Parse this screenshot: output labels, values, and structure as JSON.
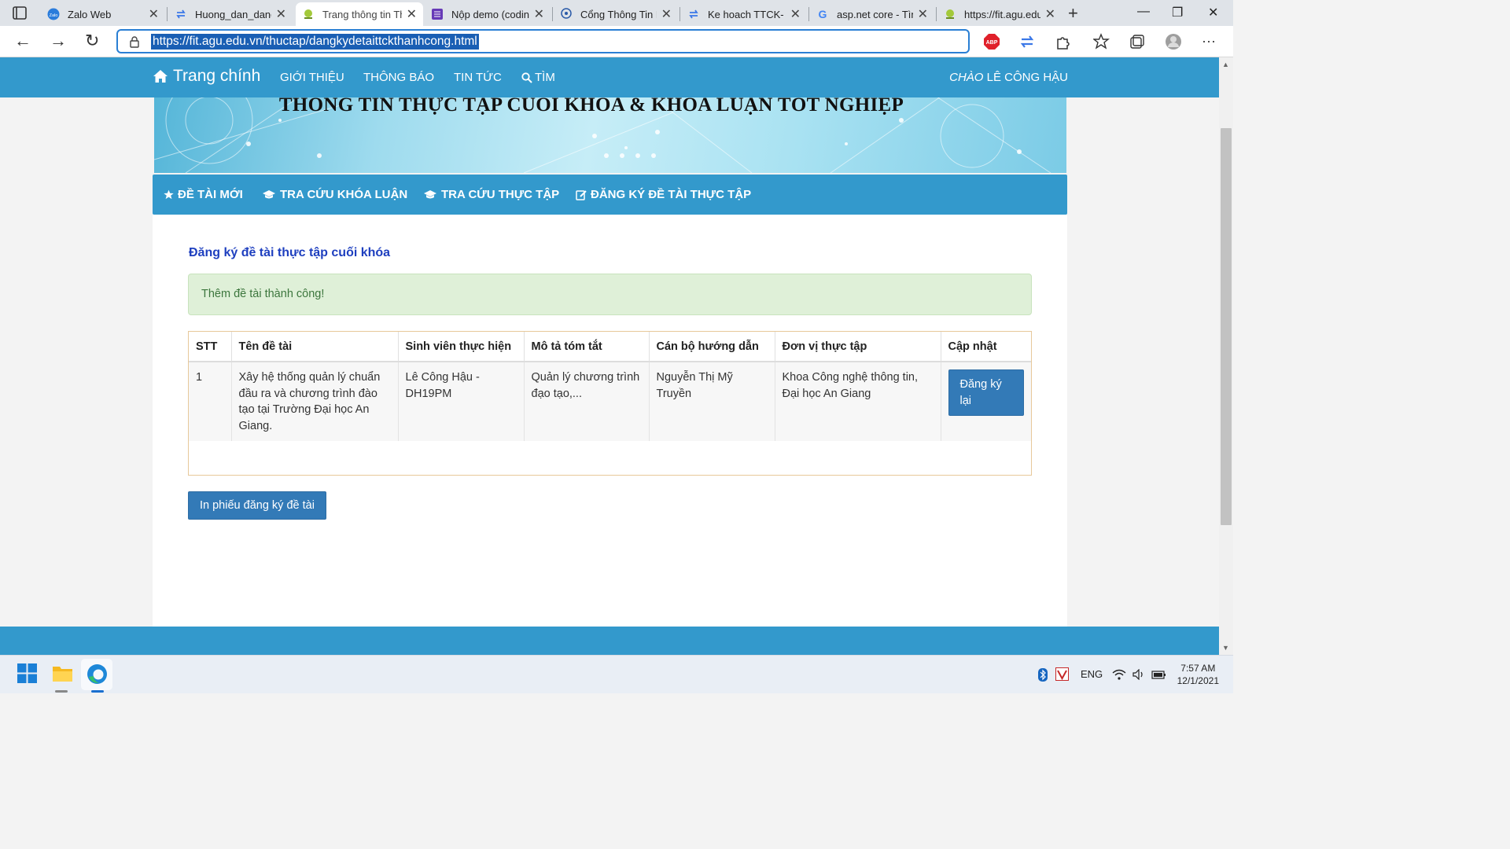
{
  "browser": {
    "tabs": [
      {
        "title": "Zalo Web",
        "icon": "zalo-icon",
        "active": false
      },
      {
        "title": "Huong_dan_dang",
        "icon": "sync-icon",
        "active": false
      },
      {
        "title": "Trang thông tin Th",
        "icon": "agu-icon",
        "active": true
      },
      {
        "title": "Nộp demo (codin",
        "icon": "form-icon",
        "active": false
      },
      {
        "title": "Cổng Thông Tin E",
        "icon": "agu-logo-icon",
        "active": false
      },
      {
        "title": "Ke hoach TTCK- K",
        "icon": "sync-icon",
        "active": false
      },
      {
        "title": "asp.net core - Tìn",
        "icon": "google-icon",
        "active": false
      },
      {
        "title": "https://fit.agu.edu",
        "icon": "agu-icon",
        "active": false
      }
    ],
    "url": "https://fit.agu.edu.vn/thuctap/dangkydetaittckthanhcong.html",
    "abp_label": "ABP"
  },
  "site": {
    "brand": "Trang chính",
    "nav": [
      "GIỚI THIỆU",
      "THÔNG BÁO",
      "TIN TỨC",
      "TÌM"
    ],
    "greeting_prefix": "CHÀO",
    "greeting_name": "LÊ CÔNG HẬU",
    "banner_title": "THÔNG TIN THỰC TẬP CUỐI KHÓA & KHÓA LUẬN TỐT NGHIỆP",
    "subnav": [
      "ĐỀ TÀI MỚI",
      "TRA CỨU KHÓA LUẬN",
      "TRA CỨU THỰC TẬP",
      "ĐĂNG KÝ ĐỀ TÀI THỰC TẬP"
    ]
  },
  "main": {
    "heading": "Đăng ký đề tài thực tập cuối khóa",
    "alert": "Thêm đề tài thành công!",
    "table": {
      "headers": [
        "STT",
        "Tên đề tài",
        "Sinh viên thực hiện",
        "Mô tả tóm tắt",
        "Cán bộ hướng dẫn",
        "Đơn vị thực tập",
        "Cập nhật"
      ],
      "rows": [
        {
          "stt": "1",
          "title": "Xây hệ thống quản lý chuẩn đầu ra và chương trình đào tạo tại Trường Đại học An Giang.",
          "student": "Lê Công Hậu - DH19PM",
          "summary": "Quản lý chương trình đạo tạo,...",
          "advisor": "Nguyễn Thị Mỹ Truyền",
          "unit": "Khoa Công nghệ thông tin, Đại học An Giang",
          "action": "Đăng ký lại"
        }
      ]
    },
    "print_button": "In phiếu đăng ký đề tài"
  },
  "taskbar": {
    "lang": "ENG",
    "time": "7:57 AM",
    "date": "12/1/2021"
  }
}
